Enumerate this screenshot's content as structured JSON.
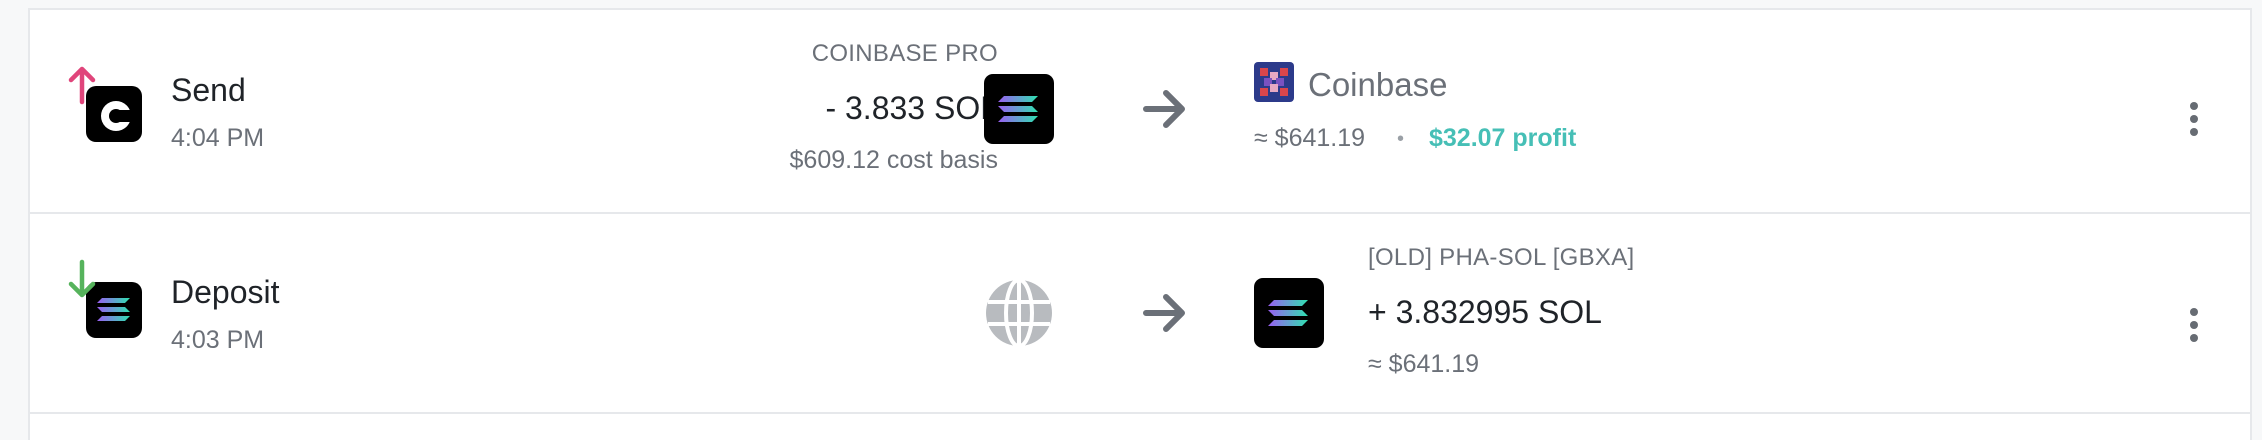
{
  "transactions": [
    {
      "type": "Send",
      "time": "4:04 PM",
      "source_label": "COINBASE PRO",
      "amount": "- 3.833 SOL",
      "cost_basis": "$609.12 cost basis",
      "destination": "Coinbase",
      "value": "≈ $641.19",
      "separator": "•",
      "profit": "$32.07 profit",
      "direction_icon": "arrow-up-icon",
      "direction_color": "#e0457b"
    },
    {
      "type": "Deposit",
      "time": "4:03 PM",
      "dest_label": "[OLD] PHA-SOL [GBXA]",
      "amount": "+ 3.832995 SOL",
      "value": "≈ $641.19",
      "direction_icon": "arrow-down-icon",
      "direction_color": "#56b35c"
    }
  ],
  "colors": {
    "profit": "#46bfb6",
    "muted_text": "#6b7078",
    "card_border": "#e6e8eb"
  }
}
